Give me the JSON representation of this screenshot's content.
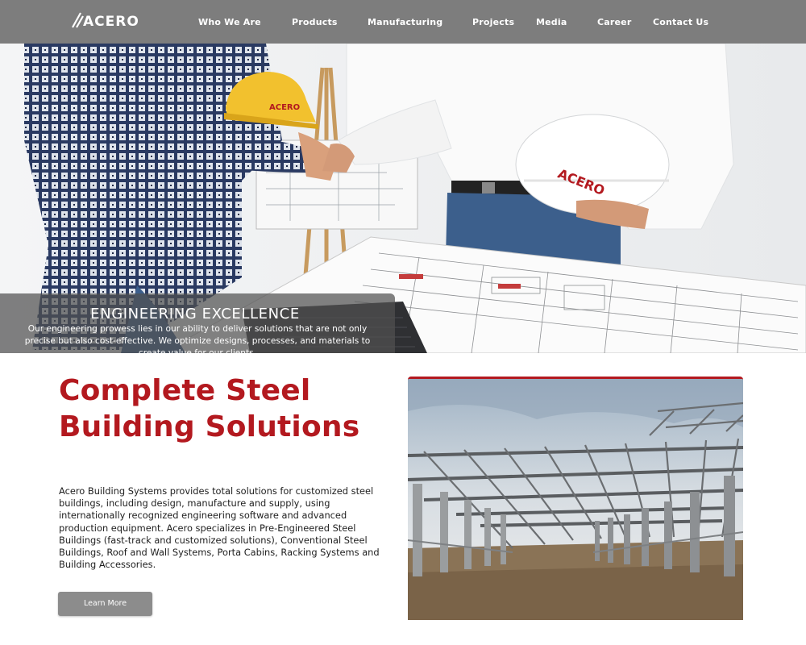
{
  "brand": {
    "logo_text": "ACERO",
    "accent_color": "#b3191f",
    "nav_bg": "#7d7d7d"
  },
  "nav": {
    "items": [
      {
        "label": "Who We Are"
      },
      {
        "label": "Products"
      },
      {
        "label": "Manufacturing"
      },
      {
        "label": "Projects"
      },
      {
        "label": "Media"
      },
      {
        "label": "Career"
      },
      {
        "label": "Contact Us"
      }
    ]
  },
  "hero": {
    "helmet_logo_text": "ACERO",
    "caption_title": "ENGINEERING EXCELLENCE",
    "caption_text": "Our engineering prowess lies in our ability to deliver solutions that are not only precise but also cost-effective. We optimize designs, processes, and materials to create value for our clients."
  },
  "intro": {
    "headline": "Complete Steel Building Solutions",
    "body": "Acero Building Systems provides total solutions for customized steel buildings, including design, manufacture and supply, using internationally recognized engineering software and advanced production equipment. Acero specializes in Pre-Engineered Steel Buildings (fast-track and customized solutions), Conventional Steel Buildings, Roof and Wall Systems, Porta Cabins, Racking Systems and Building Accessories.",
    "button_label": "Learn More"
  }
}
